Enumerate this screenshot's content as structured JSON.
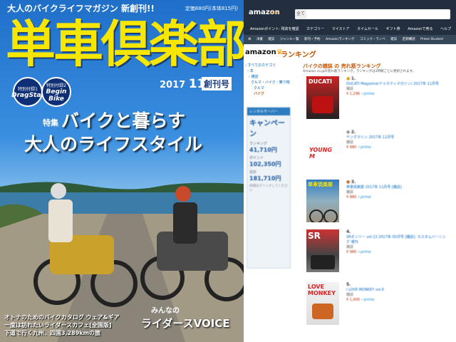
{
  "magazine": {
    "tagline": "大人のバイクライフマガジン 新創刊!!",
    "price": "定価880円(本体815円)",
    "title": "単車倶楽部",
    "issue_year": "2017",
    "issue_month": "11",
    "issue_label": "創刊号",
    "badge1": {
      "small": "特別付録1",
      "big": "DragStar"
    },
    "badge2": {
      "small": "特別付録2",
      "big": "Begin Bike"
    },
    "feature_tag": "特集",
    "headline1": "バイクと暮らす",
    "headline2": "大人のライフスタイル",
    "footer_lines": [
      "オトナのためのバイクカタログ ウェア&ギア",
      "一度は訪れたいライダースカフェ[全国版]",
      "下道で行く九州、四国3,289kmの旅"
    ],
    "voice_top": "みんなの",
    "voice": "ライダースVOICE"
  },
  "amazon": {
    "logo": "amazon",
    "logo_sub": ".co.jp",
    "search_category": "全て",
    "nav_items": [
      "Amazonポイント: 残高を確認",
      "カテゴリー",
      "マイストア",
      "タイムセール",
      "ギフト券",
      "Amazonで売る",
      "ヘルプ"
    ],
    "subnav_items": [
      "本",
      "洋書",
      "雑誌",
      "ジャンル一覧",
      "新刊・予約",
      "Amazonランキング",
      "コミック・ラノベ",
      "雑誌",
      "定期購読",
      "Prime Student"
    ],
    "ranking_logo": "amazon",
    "ranking_title": "ランキング",
    "category_title": "バイクの雑誌 の 売れ筋ランキング",
    "category_desc": "Amazon.co.jpの売れ筋ランキング。ランキングは1時間ごとに更新されます。",
    "sidebar": [
      "‹ すべてのカテゴリ",
      "‹ 本",
      "‹ 雑誌",
      "クルマ・バイク・乗り物",
      "クルマ",
      "バイク"
    ],
    "card": {
      "header": "レンタルサーバー",
      "big": "キャンペーン",
      "rows": [
        {
          "label": "ランキング",
          "value": "41,710円"
        },
        {
          "label": "ポイント",
          "value": "102,350円"
        },
        {
          "label": "合計",
          "value": "181,710円"
        }
      ],
      "note": "詳細はクリックしてください"
    },
    "items": [
      {
        "rank": "1.",
        "title": "DUCATI Magazine(ドゥカティマガジン) 2017年 11月号",
        "type": "雑誌",
        "price": "¥ 1,296",
        "prime": "✓prime"
      },
      {
        "rank": "2.",
        "title": "ヤングマシン 2017年 11月号",
        "type": "雑誌",
        "price": "¥ 980",
        "prime": "✓prime"
      },
      {
        "rank": "3.",
        "title": "単車倶楽部 2017年 11月号 [雑誌]",
        "type": "雑誌",
        "price": "¥ 880",
        "prime": "✓prime"
      },
      {
        "rank": "4.",
        "title": "SRオンリー vol.13 2017年 05月号 [雑誌]: カスタムバーニング 増刊",
        "type": "雑誌",
        "price": "¥ 980",
        "prime": "✓prime"
      },
      {
        "rank": "5.",
        "title": "I LOVE MONKEY vol.6",
        "type": "雑誌",
        "price": "¥ 1,000",
        "prime": "✓prime"
      }
    ],
    "thumb_texts": [
      "DUCATI",
      "YOUNG M",
      "単車倶楽部",
      "SR",
      "LOVE MONKEY"
    ]
  }
}
